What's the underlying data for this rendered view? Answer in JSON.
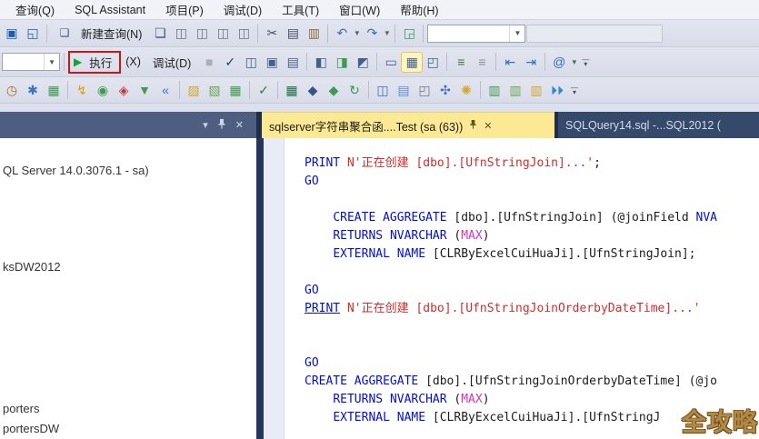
{
  "menu": {
    "items": [
      {
        "name": "menu-query",
        "label": "查询(Q)"
      },
      {
        "name": "menu-sql-assistant",
        "label": "SQL Assistant"
      },
      {
        "name": "menu-project",
        "label": "项目(P)"
      },
      {
        "name": "menu-debug",
        "label": "调试(D)"
      },
      {
        "name": "menu-tools",
        "label": "工具(T)"
      },
      {
        "name": "menu-window",
        "label": "窗口(W)"
      },
      {
        "name": "menu-help",
        "label": "帮助(H)"
      }
    ]
  },
  "toolbar1": [
    {
      "t": "i",
      "n": "save-icon",
      "g": "▣",
      "c": "#1b5eab"
    },
    {
      "t": "i",
      "n": "save-all-icon",
      "g": "◱",
      "c": "#1b5eab"
    },
    {
      "t": "s"
    },
    {
      "t": "btn",
      "n": "new-query-button",
      "g": "❏",
      "c": "#3a567e",
      "label": "新建查询(N)"
    },
    {
      "t": "i",
      "n": "database-engine-query-icon",
      "g": "❏",
      "c": "#3a567e"
    },
    {
      "t": "i",
      "n": "mdx-query-icon",
      "g": "◫",
      "c": "#6b7480"
    },
    {
      "t": "i",
      "n": "dmx-query-icon",
      "g": "◫",
      "c": "#6b7480"
    },
    {
      "t": "i",
      "n": "xmla-query-icon",
      "g": "◫",
      "c": "#6b7480"
    },
    {
      "t": "i",
      "n": "dax-query-icon",
      "g": "◫",
      "c": "#6b7480"
    },
    {
      "t": "s"
    },
    {
      "t": "i",
      "n": "cut-icon",
      "g": "✂",
      "c": "#44506a"
    },
    {
      "t": "i",
      "n": "copy-icon",
      "g": "▤",
      "c": "#44506a"
    },
    {
      "t": "i",
      "n": "paste-icon",
      "g": "▥",
      "c": "#8a6d3b"
    },
    {
      "t": "s"
    },
    {
      "t": "i",
      "n": "undo-icon",
      "g": "↶",
      "c": "#2e6fc0",
      "dd": true
    },
    {
      "t": "i",
      "n": "redo-icon",
      "g": "↷",
      "c": "#2e6fc0",
      "dd": true
    },
    {
      "t": "s"
    },
    {
      "t": "i",
      "n": "query-designer-icon",
      "g": "◲",
      "c": "#3e9b4f"
    },
    {
      "t": "s"
    },
    {
      "t": "combo",
      "n": "toolbar1-combo",
      "w": 108
    },
    {
      "t": "field",
      "n": "toolbar1-field",
      "w": 150
    }
  ],
  "toolbar2": [
    {
      "t": "combo",
      "n": "database-combo",
      "w": 64
    },
    {
      "t": "s"
    },
    {
      "t": "exec",
      "n": "execute-button",
      "play": "▶",
      "label": "执行",
      "suffix": "(X)"
    },
    {
      "t": "btn",
      "n": "debug-button",
      "g": "",
      "c": "",
      "label": "调试(D)"
    },
    {
      "t": "i",
      "n": "stop-icon",
      "g": "■",
      "c": "#a6adbb",
      "dis": true
    },
    {
      "t": "i",
      "n": "parse-check-icon",
      "g": "✓",
      "c": "#23406e"
    },
    {
      "t": "i",
      "n": "estimated-plan-icon",
      "g": "◫",
      "c": "#44618c"
    },
    {
      "t": "i",
      "n": "query-options-icon",
      "g": "▣",
      "c": "#44618c"
    },
    {
      "t": "i",
      "n": "results-pane-icon",
      "g": "▤",
      "c": "#44618c"
    },
    {
      "t": "s"
    },
    {
      "t": "i",
      "n": "actual-plan-icon",
      "g": "◧",
      "c": "#44618c"
    },
    {
      "t": "i",
      "n": "live-statistics-icon",
      "g": "◨",
      "c": "#3e9b4f"
    },
    {
      "t": "i",
      "n": "client-statistics-icon",
      "g": "◩",
      "c": "#44618c"
    },
    {
      "t": "s"
    },
    {
      "t": "i",
      "n": "results-to-text-icon",
      "g": "▭",
      "c": "#44618c"
    },
    {
      "t": "i",
      "n": "results-to-grid-icon",
      "g": "▦",
      "c": "#44618c",
      "hl": true
    },
    {
      "t": "i",
      "n": "results-to-file-icon",
      "g": "◰",
      "c": "#44618c"
    },
    {
      "t": "s"
    },
    {
      "t": "i",
      "n": "comment-icon",
      "g": "≡",
      "c": "#2f7d32"
    },
    {
      "t": "i",
      "n": "uncomment-icon",
      "g": "≡",
      "c": "#8a8f9b"
    },
    {
      "t": "s"
    },
    {
      "t": "i",
      "n": "decrease-indent-icon",
      "g": "⇤",
      "c": "#2e6fc0"
    },
    {
      "t": "i",
      "n": "increase-indent-icon",
      "g": "⇥",
      "c": "#2e6fc0"
    },
    {
      "t": "s"
    },
    {
      "t": "i",
      "n": "template-parameters-icon",
      "g": "@",
      "c": "#2e6fc0",
      "dd": true
    },
    {
      "t": "overflow",
      "n": "toolbar2-overflow"
    }
  ],
  "toolbar3": [
    {
      "t": "i",
      "n": "history-clock-icon",
      "g": "◷",
      "c": "#b06820"
    },
    {
      "t": "i",
      "n": "options-gear-icon",
      "g": "✱",
      "c": "#3b6fc4"
    },
    {
      "t": "i",
      "n": "diagram-check-icon",
      "g": "▦",
      "c": "#3e9b4f"
    },
    {
      "t": "s"
    },
    {
      "t": "i",
      "n": "sql-flash-icon",
      "g": "↯",
      "c": "#dd9a12"
    },
    {
      "t": "i",
      "n": "green-database-icon",
      "g": "◉",
      "c": "#3e9b4f"
    },
    {
      "t": "i",
      "n": "sql-stamp-icon",
      "g": "◈",
      "c": "#c23b3b"
    },
    {
      "t": "i",
      "n": "snippet-tree-icon",
      "g": "▼",
      "c": "#3e9b4f"
    },
    {
      "t": "i",
      "n": "navigate-back-icon",
      "g": "«",
      "c": "#3b6fc4"
    },
    {
      "t": "s"
    },
    {
      "t": "i",
      "n": "open-folder-icon",
      "g": "▨",
      "c": "#d6a62c"
    },
    {
      "t": "i",
      "n": "folder-code-icon",
      "g": "▧",
      "c": "#6aa84f"
    },
    {
      "t": "i",
      "n": "table-export-icon",
      "g": "▦",
      "c": "#3e9b4f"
    },
    {
      "t": "s"
    },
    {
      "t": "i",
      "n": "spellcheck-icon",
      "g": "✓",
      "c": "#2f7d32"
    },
    {
      "t": "s"
    },
    {
      "t": "i",
      "n": "excel-icon",
      "g": "▦",
      "c": "#1e7145"
    },
    {
      "t": "i",
      "n": "db-copy-icon",
      "g": "◆",
      "c": "#34558b"
    },
    {
      "t": "i",
      "n": "db-sync-icon",
      "g": "◆",
      "c": "#3e9b4f"
    },
    {
      "t": "i",
      "n": "refresh-icon",
      "g": "↻",
      "c": "#2f9e44"
    },
    {
      "t": "s"
    },
    {
      "t": "i",
      "n": "org-diagram-icon",
      "g": "◫",
      "c": "#3b6fc4"
    },
    {
      "t": "i",
      "n": "pipe-icon",
      "g": "▤",
      "c": "#5b8dd9"
    },
    {
      "t": "i",
      "n": "archive-up-icon",
      "g": "◰",
      "c": "#6b7b8d"
    },
    {
      "t": "i",
      "n": "gears-blue-icon",
      "g": "✣",
      "c": "#3b6fc4"
    },
    {
      "t": "i",
      "n": "gear-gold-icon",
      "g": "✺",
      "c": "#d6a62c"
    },
    {
      "t": "s"
    },
    {
      "t": "i",
      "n": "db-doc-green-icon",
      "g": "▥",
      "c": "#3e9b4f"
    },
    {
      "t": "i",
      "n": "db-doc-green2-icon",
      "g": "▥",
      "c": "#6aa84f"
    },
    {
      "t": "i",
      "n": "db-doc-gold-icon",
      "g": "▥",
      "c": "#d6a62c"
    },
    {
      "t": "i",
      "n": "play-next-icon",
      "g": "⏵⏵",
      "c": "#2f86d1"
    },
    {
      "t": "overflow",
      "n": "toolbar3-overflow"
    }
  ],
  "panel": {
    "items": [
      {
        "name": "tree-item-server",
        "label": "QL Server 14.0.3076.1 - sa)"
      },
      {
        "name": "tree-item-database-1",
        "label": "ksDW2012"
      },
      {
        "name": "tree-item-database-2",
        "label": "porters"
      },
      {
        "name": "tree-item-database-3",
        "label": "portersDW"
      }
    ]
  },
  "tabs": [
    {
      "name": "tab-aggregate-script",
      "label": "sqlserver字符串聚合函....Test (sa (63))",
      "active": true
    },
    {
      "name": "tab-sqlquery14",
      "label": "SQLQuery14.sql -...SQL2012 (",
      "active": false
    }
  ],
  "code": {
    "lines": [
      [
        [
          "k",
          "PRINT"
        ],
        [
          "p",
          " "
        ],
        [
          "s",
          "N'正在创建 [dbo].[UfnStringJoin]...'"
        ],
        [
          "p",
          ";"
        ]
      ],
      [
        [
          "k",
          "GO"
        ]
      ],
      [],
      [
        [
          "p",
          "    "
        ],
        [
          "k",
          "CREATE"
        ],
        [
          "p",
          " "
        ],
        [
          "k",
          "AGGREGATE"
        ],
        [
          "p",
          " [dbo].[UfnStringJoin] (@joinField "
        ],
        [
          "k",
          "NVA"
        ]
      ],
      [
        [
          "p",
          "    "
        ],
        [
          "k",
          "RETURNS"
        ],
        [
          "p",
          " "
        ],
        [
          "k",
          "NVARCHAR"
        ],
        [
          "p",
          " ("
        ],
        [
          "m",
          "MAX"
        ],
        [
          "p",
          ")"
        ]
      ],
      [
        [
          "p",
          "    "
        ],
        [
          "k",
          "EXTERNAL"
        ],
        [
          "p",
          " "
        ],
        [
          "k",
          "NAME"
        ],
        [
          "p",
          " [CLRByExcelCuiHuaJi].[UfnStringJoin];"
        ]
      ],
      [],
      [
        [
          "k",
          "GO"
        ]
      ],
      [
        [
          "u",
          "PRINT"
        ],
        [
          "p",
          " "
        ],
        [
          "s",
          "N'正在创建 [dbo].[UfnStringJoinOrderbyDateTime]...'"
        ]
      ],
      [],
      [],
      [
        [
          "k",
          "GO"
        ]
      ],
      [
        [
          "k",
          "CREATE"
        ],
        [
          "p",
          " "
        ],
        [
          "k",
          "AGGREGATE"
        ],
        [
          "p",
          " [dbo].[UfnStringJoinOrderbyDateTime] (@jo"
        ]
      ],
      [
        [
          "p",
          "    "
        ],
        [
          "k",
          "RETURNS"
        ],
        [
          "p",
          " "
        ],
        [
          "k",
          "NVARCHAR"
        ],
        [
          "p",
          " ("
        ],
        [
          "m",
          "MAX"
        ],
        [
          "p",
          ")"
        ]
      ],
      [
        [
          "p",
          "    "
        ],
        [
          "k",
          "EXTERNAL"
        ],
        [
          "p",
          " "
        ],
        [
          "k",
          "NAME"
        ],
        [
          "p",
          " [CLRByExcelCuiHuaJi].[UfnStringJ"
        ]
      ]
    ]
  },
  "watermark": {
    "text": "全攻略"
  },
  "colors": {
    "accent_red_box": "#cf1414",
    "active_tab": "#fbea93",
    "inactive_tab": "#35496b",
    "panel_header": "#4d5e80",
    "keyword": "#0010d8",
    "string": "#d42b2b",
    "max_literal": "#d335c9",
    "watermark_gold": "#b28a42"
  }
}
